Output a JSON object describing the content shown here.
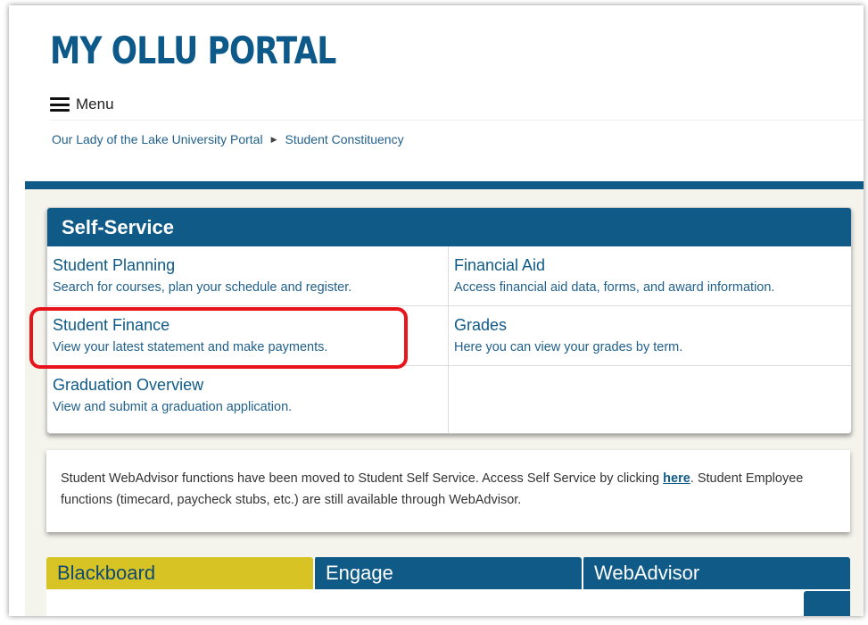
{
  "header": {
    "title": "MY OLLU PORTAL",
    "menu_label": "Menu"
  },
  "breadcrumb": [
    "Our Lady of the Lake University Portal",
    "Student Constituency"
  ],
  "self_service": {
    "heading": "Self-Service",
    "items": [
      {
        "title": "Student Planning",
        "description": "Search for courses, plan your schedule and register."
      },
      {
        "title": "Financial Aid",
        "description": "Access financial aid data, forms, and award information."
      },
      {
        "title": "Student Finance",
        "description": "View your latest statement and make payments."
      },
      {
        "title": "Grades",
        "description": "Here you can view your grades by term."
      },
      {
        "title": "Graduation Overview",
        "description": "View and submit a graduation application."
      }
    ]
  },
  "notice": {
    "text_before": "Student WebAdvisor functions have been moved to Student Self Service. Access Self Service by clicking ",
    "link": "here",
    "text_after": ". Student Employee functions (timecard, paycheck stubs, etc.) are still available through WebAdvisor."
  },
  "tabs": [
    "Blackboard",
    "Engage",
    "WebAdvisor"
  ],
  "colors": {
    "brand_blue": "#0f5a86",
    "tab_yellow": "#d7c324",
    "highlight_red": "#e8131b"
  }
}
